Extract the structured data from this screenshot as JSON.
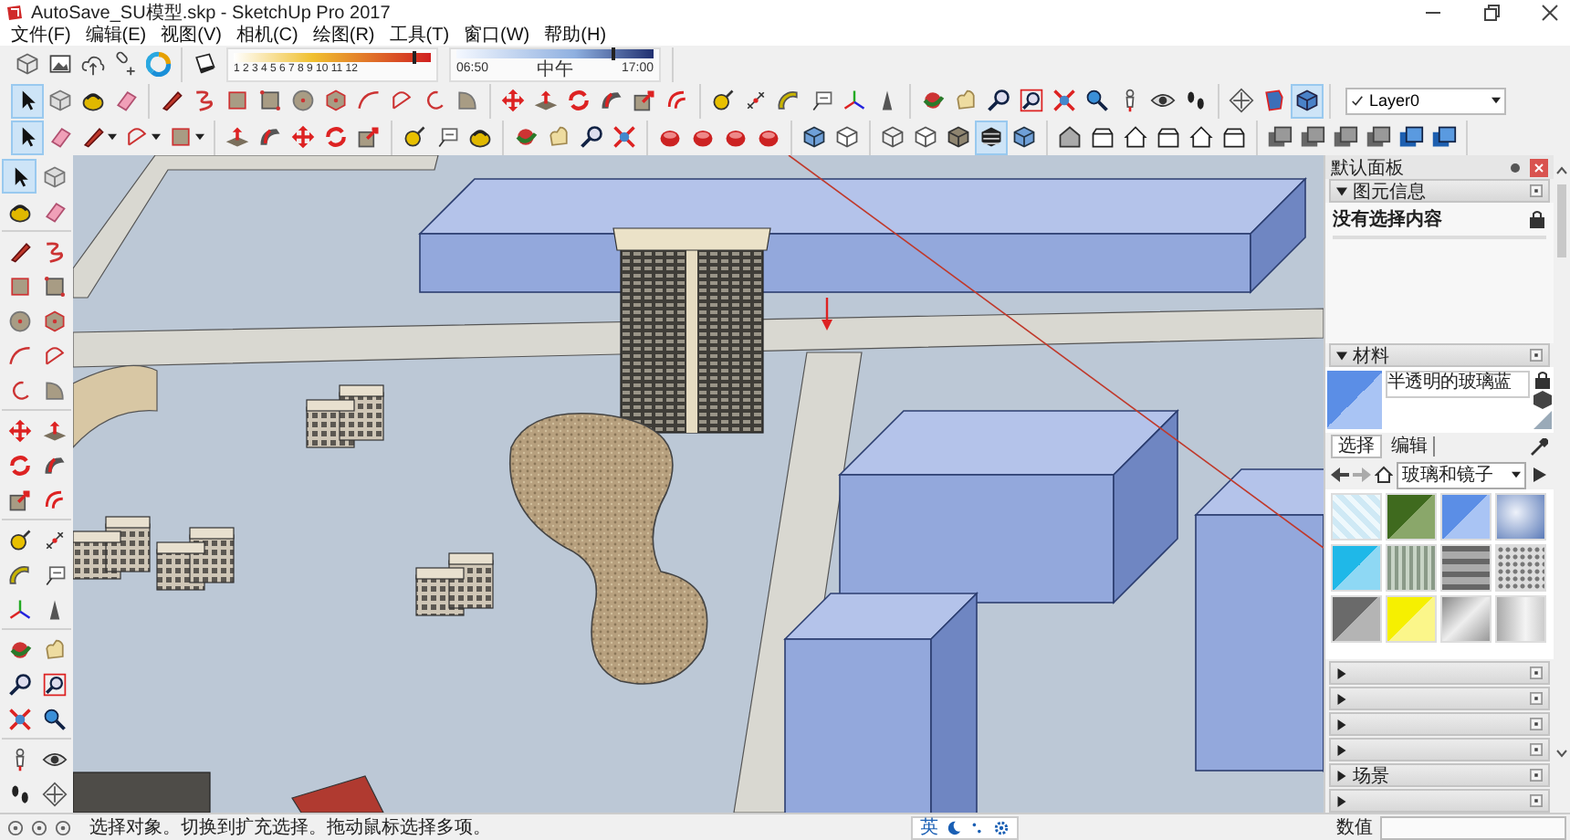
{
  "window": {
    "title": "AutoSave_SU模型.skp - SketchUp Pro 2017"
  },
  "menu": [
    "文件(F)",
    "编辑(E)",
    "视图(V)",
    "相机(C)",
    "绘图(R)",
    "工具(T)",
    "窗口(W)",
    "帮助(H)"
  ],
  "getting_started_bar": {
    "tools": [
      {
        "kind": "warehouse",
        "selected": false
      },
      {
        "kind": "image",
        "selected": false
      },
      {
        "kind": "cloud",
        "selected": false
      },
      {
        "kind": "link",
        "selected": false
      },
      {
        "kind": "ring",
        "selected": false
      }
    ]
  },
  "shadow_bar": {
    "tools": [
      {
        "kind": "shadow",
        "selected": false
      }
    ],
    "month_slider": {
      "labels": "1 2 3 4 5 6 7 8 9 10 11 12",
      "level": 0.92
    },
    "time_slider": {
      "labels": [
        "06:50",
        "中午",
        "17:00"
      ],
      "level": 0.8
    }
  },
  "tool_rows": [
    {
      "groups": [
        {
          "tools": [
            {
              "kind": "select",
              "selected": true
            },
            {
              "kind": "component",
              "selected": false
            },
            {
              "kind": "paint",
              "selected": false
            },
            {
              "kind": "eraser",
              "selected": false
            }
          ]
        },
        {
          "tools": [
            {
              "kind": "line",
              "selected": false
            },
            {
              "kind": "freehand",
              "selected": false
            },
            {
              "kind": "rectangle",
              "selected": false
            },
            {
              "kind": "rotated_rect",
              "selected": false
            },
            {
              "kind": "circle",
              "selected": false
            },
            {
              "kind": "polygon",
              "selected": false
            },
            {
              "kind": "arc",
              "selected": false
            },
            {
              "kind": "arc2",
              "selected": false
            },
            {
              "kind": "arc3",
              "selected": false
            },
            {
              "kind": "pie",
              "selected": false
            }
          ]
        },
        {
          "tools": [
            {
              "kind": "move",
              "selected": false
            },
            {
              "kind": "pushpull",
              "selected": false
            },
            {
              "kind": "rotate",
              "selected": false
            },
            {
              "kind": "followme",
              "selected": false
            },
            {
              "kind": "scale",
              "selected": false
            },
            {
              "kind": "offset",
              "selected": false
            }
          ]
        },
        {
          "tools": [
            {
              "kind": "tape",
              "selected": false
            },
            {
              "kind": "dimension",
              "selected": false
            },
            {
              "kind": "protractor",
              "selected": false
            },
            {
              "kind": "label",
              "selected": false
            },
            {
              "kind": "axes",
              "selected": false
            },
            {
              "kind": "text3d",
              "selected": false
            }
          ]
        },
        {
          "tools": [
            {
              "kind": "orbit",
              "selected": false
            },
            {
              "kind": "pan",
              "selected": false
            },
            {
              "kind": "zoom",
              "selected": false
            },
            {
              "kind": "zoomwindow",
              "selected": false
            },
            {
              "kind": "zoomext",
              "selected": false
            },
            {
              "kind": "previous",
              "selected": false
            },
            {
              "kind": "camera",
              "selected": false
            },
            {
              "kind": "lookaround",
              "selected": false
            },
            {
              "kind": "walk",
              "selected": false
            }
          ]
        },
        {
          "tools": [
            {
              "kind": "section",
              "selected": false
            },
            {
              "kind": "sectiondisplay",
              "selected": false
            },
            {
              "kind": "sectioncut",
              "selected": true
            }
          ]
        }
      ],
      "layer_select": {
        "value": "Layer0"
      }
    },
    {
      "groups": [
        {
          "tools": [
            {
              "kind": "select",
              "selected": true
            },
            {
              "kind": "eraser",
              "selected": false
            },
            {
              "kind": "line",
              "selected": false,
              "has_menu": true
            },
            {
              "kind": "arc2",
              "selected": false,
              "has_menu": true
            },
            {
              "kind": "rectangle",
              "selected": false,
              "has_menu": true
            }
          ]
        },
        {
          "tools": [
            {
              "kind": "pushpull",
              "selected": false
            },
            {
              "kind": "followme",
              "selected": false
            },
            {
              "kind": "move",
              "selected": false
            },
            {
              "kind": "rotate",
              "selected": false
            },
            {
              "kind": "scale",
              "selected": false
            }
          ]
        },
        {
          "tools": [
            {
              "kind": "tape",
              "selected": false
            },
            {
              "kind": "label",
              "selected": false
            },
            {
              "kind": "paint",
              "selected": false
            }
          ]
        },
        {
          "tools": [
            {
              "kind": "orbit",
              "selected": false
            },
            {
              "kind": "pan",
              "selected": false
            },
            {
              "kind": "zoom",
              "selected": false
            },
            {
              "kind": "zoomext",
              "selected": false
            }
          ]
        },
        {
          "tools": [
            {
              "kind": "ruby",
              "selected": false
            },
            {
              "kind": "ruby",
              "selected": false
            },
            {
              "kind": "ruby",
              "selected": false
            },
            {
              "kind": "ruby",
              "selected": false
            }
          ]
        },
        {
          "tools": [
            {
              "kind": "style_mono",
              "selected": false
            },
            {
              "kind": "style_hidden",
              "selected": false
            }
          ]
        },
        {
          "tools": [
            {
              "kind": "style_wire",
              "selected": false
            },
            {
              "kind": "style_hidden",
              "selected": false
            },
            {
              "kind": "style_shaded",
              "selected": false
            },
            {
              "kind": "style_texture",
              "selected": true
            },
            {
              "kind": "style_mono",
              "selected": false
            }
          ]
        },
        {
          "tools": [
            {
              "kind": "view_iso",
              "selected": false
            },
            {
              "kind": "view_box",
              "selected": false
            },
            {
              "kind": "view_house",
              "selected": false
            },
            {
              "kind": "view_box",
              "selected": false
            },
            {
              "kind": "view_house",
              "selected": false
            },
            {
              "kind": "view_box",
              "selected": false
            }
          ]
        },
        {
          "tools": [
            {
              "kind": "layers",
              "selected": false
            },
            {
              "kind": "layers",
              "selected": false
            },
            {
              "kind": "layers",
              "selected": false
            },
            {
              "kind": "layers",
              "selected": false
            },
            {
              "kind": "layers_blue",
              "selected": false
            },
            {
              "kind": "layers_blue",
              "selected": false
            }
          ]
        }
      ]
    }
  ],
  "side_toolbar": {
    "groups": [
      {
        "tools": [
          {
            "kind": "select",
            "selected": true
          },
          {
            "kind": "component",
            "selected": false
          },
          {
            "kind": "paint",
            "selected": false
          },
          {
            "kind": "eraser",
            "selected": false
          }
        ]
      },
      {
        "tools": [
          {
            "kind": "line",
            "selected": false
          },
          {
            "kind": "freehand",
            "selected": false
          },
          {
            "kind": "rectangle",
            "selected": false
          },
          {
            "kind": "rotated_rect",
            "selected": false
          },
          {
            "kind": "circle",
            "selected": false
          },
          {
            "kind": "polygon",
            "selected": false
          },
          {
            "kind": "arc",
            "selected": false
          },
          {
            "kind": "arc2",
            "selected": false
          },
          {
            "kind": "arc3",
            "selected": false
          },
          {
            "kind": "pie",
            "selected": false
          }
        ]
      },
      {
        "tools": [
          {
            "kind": "move",
            "selected": false
          },
          {
            "kind": "pushpull",
            "selected": false
          },
          {
            "kind": "rotate",
            "selected": false
          },
          {
            "kind": "followme",
            "selected": false
          },
          {
            "kind": "scale",
            "selected": false
          },
          {
            "kind": "offset",
            "selected": false
          }
        ]
      },
      {
        "tools": [
          {
            "kind": "tape",
            "selected": false
          },
          {
            "kind": "dimension",
            "selected": false
          },
          {
            "kind": "protractor",
            "selected": false
          },
          {
            "kind": "label",
            "selected": false
          },
          {
            "kind": "axes",
            "selected": false
          },
          {
            "kind": "text3d",
            "selected": false
          }
        ]
      },
      {
        "tools": [
          {
            "kind": "orbit",
            "selected": false
          },
          {
            "kind": "pan",
            "selected": false
          },
          {
            "kind": "zoom",
            "selected": false
          },
          {
            "kind": "zoomwindow",
            "selected": false
          },
          {
            "kind": "zoomext",
            "selected": false
          },
          {
            "kind": "previous",
            "selected": false
          }
        ]
      },
      {
        "tools": [
          {
            "kind": "camera",
            "selected": false
          },
          {
            "kind": "lookaround",
            "selected": false
          },
          {
            "kind": "walk",
            "selected": false
          },
          {
            "kind": "section",
            "selected": false
          }
        ]
      }
    ]
  },
  "panel": {
    "title": "默认面板",
    "sections": [
      {
        "kind": "entity_info",
        "title": "图元信息",
        "expanded": true,
        "text": "没有选择内容"
      },
      {
        "kind": "materials",
        "title": "材料",
        "expanded": true,
        "material_name": "半透明的玻璃蓝",
        "tabs": [
          {
            "label": "选择",
            "selected": true
          },
          {
            "label": "编辑",
            "selected": false
          }
        ],
        "library": "玻璃和镜子"
      },
      {
        "kind": "collapsed",
        "expanded": false
      },
      {
        "kind": "collapsed",
        "expanded": false
      },
      {
        "kind": "collapsed",
        "expanded": false
      },
      {
        "kind": "collapsed",
        "expanded": false
      },
      {
        "kind": "collapsed",
        "title": "场景",
        "expanded": false
      },
      {
        "kind": "collapsed",
        "expanded": false
      }
    ]
  },
  "status_bar": {
    "message": "选择对象。切换到扩充选择。拖动鼠标选择多项。",
    "ime": "英",
    "measurements_label": "数值"
  }
}
